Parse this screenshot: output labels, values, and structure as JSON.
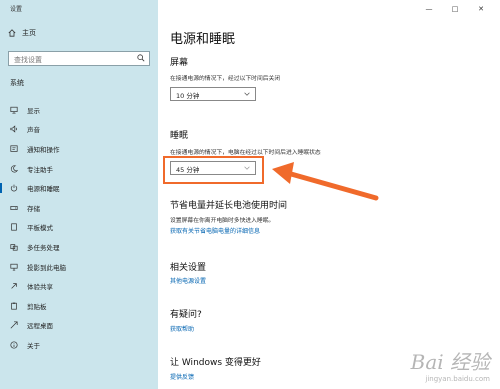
{
  "window": {
    "title": "设置",
    "controls": [
      "—",
      "□",
      "✕"
    ]
  },
  "sidebar": {
    "home_label": "主页",
    "search_placeholder": "查找设置",
    "section": "系统",
    "items": [
      {
        "label": "显示",
        "icon": "monitor-icon"
      },
      {
        "label": "声音",
        "icon": "speaker-icon"
      },
      {
        "label": "通知和操作",
        "icon": "notification-icon"
      },
      {
        "label": "专注助手",
        "icon": "moon-icon"
      },
      {
        "label": "电源和睡眠",
        "icon": "power-icon",
        "active": true
      },
      {
        "label": "存储",
        "icon": "storage-icon"
      },
      {
        "label": "平板模式",
        "icon": "tablet-icon"
      },
      {
        "label": "多任务处理",
        "icon": "multitask-icon"
      },
      {
        "label": "投影到此电脑",
        "icon": "project-icon"
      },
      {
        "label": "体验共享",
        "icon": "share-icon"
      },
      {
        "label": "剪贴板",
        "icon": "clipboard-icon"
      },
      {
        "label": "远程桌面",
        "icon": "remote-icon"
      },
      {
        "label": "关于",
        "icon": "info-icon"
      }
    ]
  },
  "main": {
    "title": "电源和睡眠",
    "screen": {
      "heading": "屏幕",
      "desc": "在接通电源的情况下，经过以下时间后关闭",
      "value": "10 分钟"
    },
    "sleep": {
      "heading": "睡眠",
      "desc": "在接通电源的情况下，电脑在经过以下时间后进入睡眠状态",
      "value": "45 分钟"
    },
    "battery": {
      "heading": "节省电量并延长电池使用时间",
      "desc": "设置屏幕在你离开电脑时多快进入睡眠。",
      "link": "获取有关节省电脑电量的详细信息"
    },
    "related": {
      "heading": "相关设置",
      "link": "其他电源设置"
    },
    "question": {
      "heading": "有疑问?",
      "link": "获取帮助"
    },
    "better": {
      "heading": "让 Windows 变得更好",
      "link": "提供反馈"
    }
  },
  "annotation": {
    "color": "#f06a2b"
  },
  "watermark": {
    "text": "Bai 经验",
    "sub": "jingyan.baidu.com"
  }
}
